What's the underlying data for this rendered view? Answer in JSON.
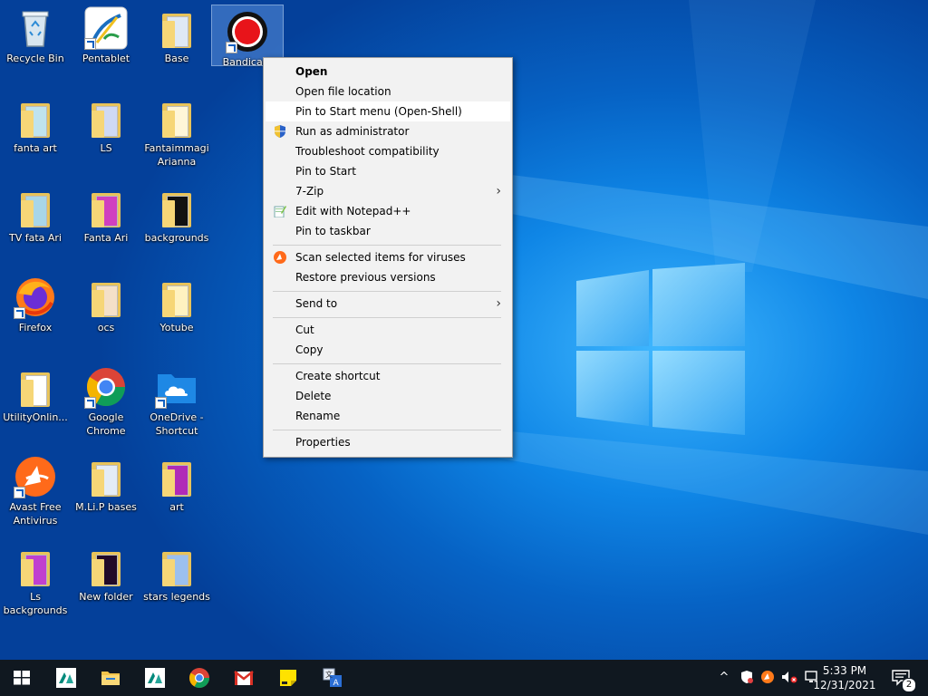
{
  "desktop": {
    "icons": [
      {
        "label": "Recycle Bin"
      },
      {
        "label": "Pentablet"
      },
      {
        "label": "Base"
      },
      {
        "label": "Bandicam"
      },
      {
        "label": "fanta art"
      },
      {
        "label": "LS"
      },
      {
        "label": "Fantaimmagi Arianna"
      },
      {
        "label": "TV fata Ari"
      },
      {
        "label": "Fanta Ari"
      },
      {
        "label": "backgrounds"
      },
      {
        "label": "Firefox"
      },
      {
        "label": "ocs"
      },
      {
        "label": "Yotube"
      },
      {
        "label": "UtilityOnlin..."
      },
      {
        "label": "Google Chrome"
      },
      {
        "label": "OneDrive - Shortcut"
      },
      {
        "label": "Avast Free Antivirus"
      },
      {
        "label": "M.Li.P bases"
      },
      {
        "label": "art"
      },
      {
        "label": "Ls backgrounds"
      },
      {
        "label": "New folder"
      },
      {
        "label": "stars legends"
      }
    ]
  },
  "context_menu": {
    "items": [
      {
        "label": "Open"
      },
      {
        "label": "Open file location"
      },
      {
        "label": "Pin to Start menu (Open-Shell)"
      },
      {
        "label": "Run as administrator"
      },
      {
        "label": "Troubleshoot compatibility"
      },
      {
        "label": "Pin to Start"
      },
      {
        "label": "7-Zip"
      },
      {
        "label": "Edit with Notepad++"
      },
      {
        "label": "Pin to taskbar"
      },
      {
        "label": "Scan selected items for viruses"
      },
      {
        "label": "Restore previous versions"
      },
      {
        "label": "Send to"
      },
      {
        "label": "Cut"
      },
      {
        "label": "Copy"
      },
      {
        "label": "Create shortcut"
      },
      {
        "label": "Delete"
      },
      {
        "label": "Rename"
      },
      {
        "label": "Properties"
      }
    ],
    "submenu_arrow": "›"
  },
  "taskbar": {
    "time": "5:33 PM",
    "date": "12/31/2021",
    "notification_count": "2",
    "tray_chevron": "^"
  },
  "colors": {
    "desktop_accent": "#0a78dc",
    "menu_bg": "#f2f2f2",
    "taskbar_bg": "#101820"
  }
}
